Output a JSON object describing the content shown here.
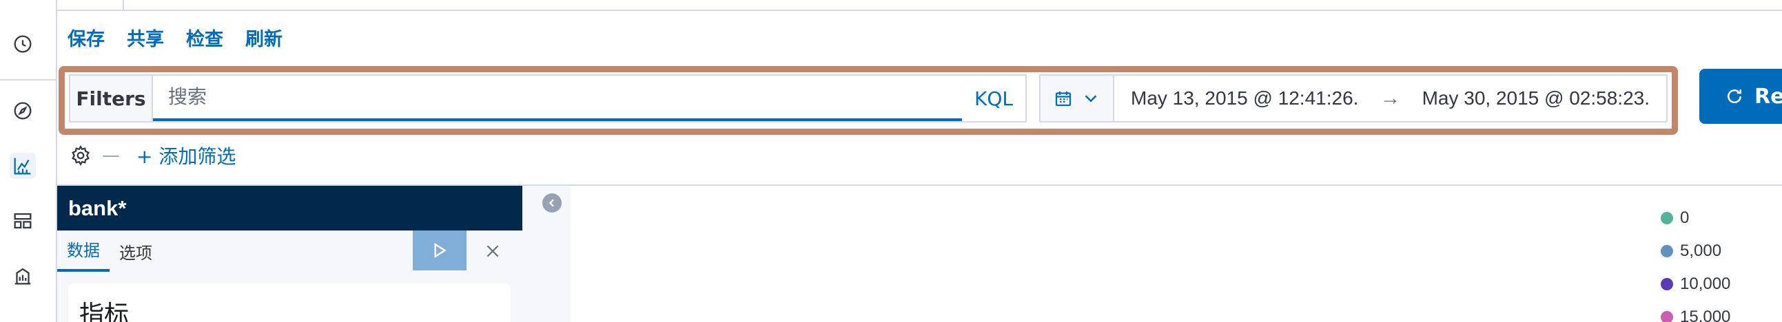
{
  "top_menu": {
    "save": "保存",
    "share": "共享",
    "inspect": "检查",
    "refresh": "刷新"
  },
  "query_bar": {
    "filters_label": "Filters",
    "search_placeholder": "搜索",
    "language": "KQL",
    "date_start": "May 13, 2015 @ 12:41:26.",
    "arrow": "→",
    "date_end": "May 30, 2015 @ 02:58:23.",
    "refresh_label": "Re"
  },
  "filter_row": {
    "dash": "—",
    "add_filter": "+ 添加筛选"
  },
  "editor": {
    "index_pattern": "bank*",
    "tabs": [
      {
        "label": "数据"
      },
      {
        "label": "选项"
      }
    ],
    "metrics_title": "指标"
  },
  "legend": {
    "items": [
      {
        "label": "0",
        "color": "#54b399"
      },
      {
        "label": "5,000",
        "color": "#6092c0"
      },
      {
        "label": "10,000",
        "color": "#5a3bb3"
      },
      {
        "label": "15,000",
        "color": "#ca5eb0"
      }
    ]
  },
  "colors": {
    "accent": "#006bb8",
    "header": "#00294c",
    "highlight": "#c2866a"
  }
}
